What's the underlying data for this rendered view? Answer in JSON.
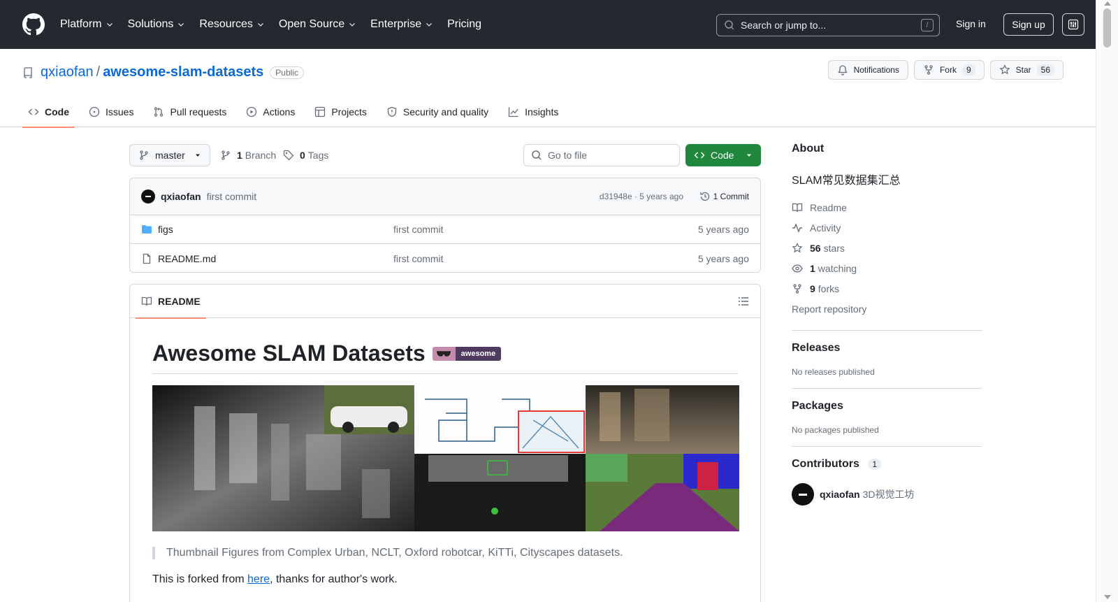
{
  "header": {
    "nav": [
      "Platform",
      "Solutions",
      "Resources",
      "Open Source",
      "Enterprise",
      "Pricing"
    ],
    "search_placeholder": "Search or jump to...",
    "search_key": "/",
    "sign_in": "Sign in",
    "sign_up": "Sign up"
  },
  "repo": {
    "owner": "qxiaofan",
    "separator": "/",
    "name": "awesome-slam-datasets",
    "visibility": "Public",
    "notifications_label": "Notifications",
    "fork_label": "Fork",
    "fork_count": "9",
    "star_label": "Star",
    "star_count": "56"
  },
  "tabs": [
    "Code",
    "Issues",
    "Pull requests",
    "Actions",
    "Projects",
    "Security and quality",
    "Insights"
  ],
  "toolbar": {
    "branch": "master",
    "branch_count": "1",
    "branch_label": "Branch",
    "tag_count": "0",
    "tag_label": "Tags",
    "goto_placeholder": "Go to file",
    "code_label": "Code"
  },
  "commit": {
    "author": "qxiaofan",
    "message": "first commit",
    "meta": "d31948e · 5 years ago",
    "count": "1 Commit"
  },
  "files": [
    {
      "name": "figs",
      "message": "first commit",
      "age": "5 years ago",
      "type": "folder"
    },
    {
      "name": "README.md",
      "message": "first commit",
      "age": "5 years ago",
      "type": "file"
    }
  ],
  "readme": {
    "tab_label": "README",
    "title": "Awesome SLAM Datasets",
    "badge_text": "awesome",
    "quote": "Thumbnail Figures from Complex Urban, NCLT, Oxford robotcar, KiTTi, Cityscapes datasets.",
    "para_before": "This is forked from ",
    "para_link": "here",
    "para_after": ", thanks for author's work."
  },
  "about": {
    "heading": "About",
    "description": "SLAM常见数据集汇总",
    "readme": "Readme",
    "activity": "Activity",
    "stars_count": "56",
    "stars_label": "stars",
    "watching_count": "1",
    "watching_label": "watching",
    "forks_count": "9",
    "forks_label": "forks",
    "report": "Report repository"
  },
  "releases": {
    "heading": "Releases",
    "empty": "No releases published"
  },
  "packages": {
    "heading": "Packages",
    "empty": "No packages published"
  },
  "contributors": {
    "heading": "Contributors",
    "count": "1",
    "name": "qxiaofan",
    "display": "3D视觉工坊"
  },
  "colors": {
    "accent": "#0969da",
    "header_bg": "#24292f",
    "code_button": "#1f883d",
    "tab_underline": "#fd8c73"
  }
}
